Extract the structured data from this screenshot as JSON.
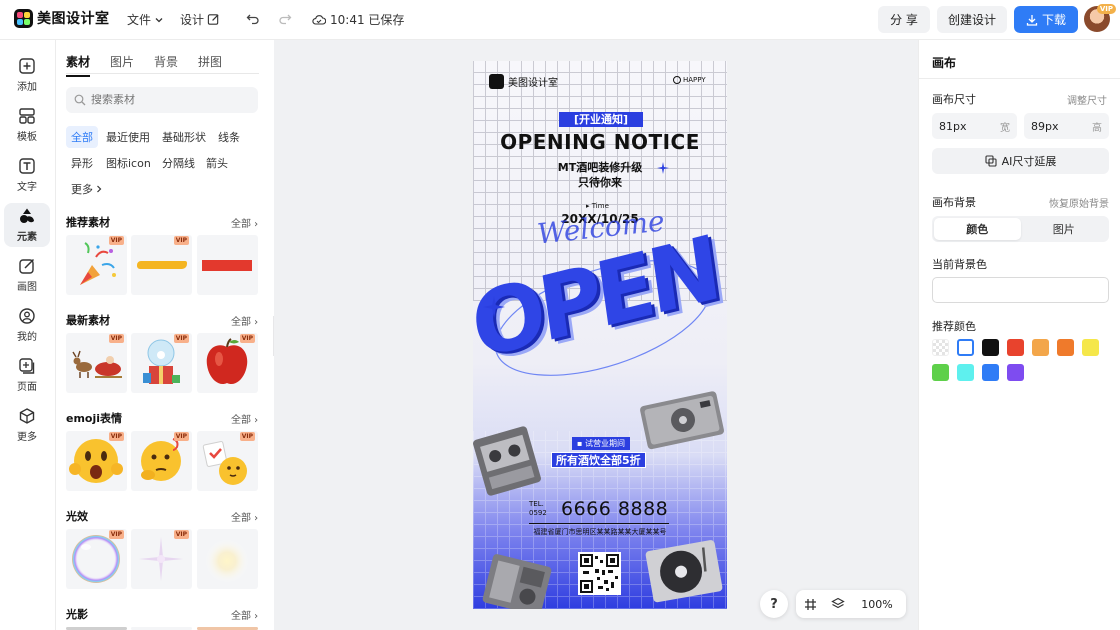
{
  "app": {
    "name": "美图设计室"
  },
  "topbar": {
    "file_menu": "文件",
    "design_menu": "设计",
    "save_status": "10:41 已保存",
    "share_label": "分 享",
    "create_label": "创建设计",
    "download_label": "下载",
    "avatar_badge": "VIP"
  },
  "rail": {
    "items": [
      {
        "label": "添加",
        "icon": "plus-square-icon"
      },
      {
        "label": "模板",
        "icon": "template-icon"
      },
      {
        "label": "文字",
        "icon": "text-icon"
      },
      {
        "label": "元素",
        "icon": "shapes-icon"
      },
      {
        "label": "画图",
        "icon": "draw-icon"
      },
      {
        "label": "我的",
        "icon": "user-icon"
      },
      {
        "label": "页面",
        "icon": "page-add-icon"
      },
      {
        "label": "更多",
        "icon": "cube-icon"
      }
    ]
  },
  "materials": {
    "tabs": [
      "素材",
      "图片",
      "背景",
      "拼图"
    ],
    "search_placeholder": "搜索素材",
    "chips": [
      "全部",
      "最近使用",
      "基础形状",
      "线条",
      "异形",
      "图标icon",
      "分隔线",
      "箭头",
      "更多"
    ],
    "vip_badge": "VIP",
    "sections": [
      {
        "title": "推荐素材",
        "all": "全部"
      },
      {
        "title": "最新素材",
        "all": "全部"
      },
      {
        "title": "emoji表情",
        "all": "全部"
      },
      {
        "title": "光效",
        "all": "全部"
      },
      {
        "title": "光影",
        "all": "全部"
      }
    ]
  },
  "poster": {
    "brand": "美图设计室",
    "happy": "HAPPY",
    "banner": "[开业通知]",
    "headline": "OPENING NOTICE",
    "sub1": "MT酒吧装修升级",
    "sub2": "只待你来",
    "time_label": "Time",
    "date": "20XX/10/25",
    "welcome": "Welcome",
    "big_word": "OPEN",
    "trial_label": "试营业期间",
    "discount": "所有酒饮全部5折",
    "tel_label": "TEL.",
    "area_code": "0592",
    "phone": "6666 8888",
    "address": "福建省厦门市思明区某某路某某大厦某某号"
  },
  "canvas": {
    "zoom": "100%",
    "help": "?"
  },
  "props": {
    "title": "画布",
    "size_label": "画布尺寸",
    "size_adjust": "调整尺寸",
    "width_value": "81px",
    "width_unit": "宽",
    "height_value": "89px",
    "height_unit": "高",
    "ai_extend": "AI尺寸延展",
    "bg_label": "画布背景",
    "bg_reset": "恢复原始背景",
    "seg_color": "颜色",
    "seg_image": "图片",
    "current_bg_label": "当前背景色",
    "recommend_label": "推荐颜色",
    "swatches": [
      "transparent",
      "#ffffff",
      "#111111",
      "#e8432d",
      "#f3a64a",
      "#ef7a2b",
      "#f5e74a",
      "#5ed04a",
      "#5ef0ee",
      "#2f7cf6",
      "#7e4cf0"
    ]
  }
}
